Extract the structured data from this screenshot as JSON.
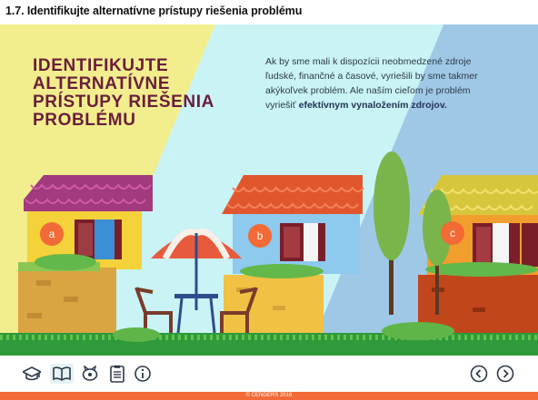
{
  "header": {
    "title": "1.7. Identifikujte alternatívne prístupy riešenia problému"
  },
  "slide": {
    "heading": "IDENTIFIKUJTE\nALTERNATÍVNE\nPRÍSTUPY RIEŠENIA\nPROBLÉMU",
    "paragraph_normal": "Ak by sme mali k dispozícii neobmedzené zdroje ľudské, finančné a časové, vyriešili by sme takmer akýkoľvek problém. Ale naším cieľom je problém vyriešiť ",
    "paragraph_bold": "efektívnym vynaložením zdrojov.",
    "options": [
      "a",
      "b",
      "c"
    ]
  },
  "toolbar": {
    "icons": [
      "graduation-cap-icon",
      "book-icon",
      "piggy-bank-icon",
      "document-icon",
      "info-icon"
    ],
    "nav": [
      "prev-arrow-icon",
      "next-arrow-icon"
    ]
  },
  "footer": {
    "copyright": "© CENGERS 2016"
  },
  "colors": {
    "heading": "#6b1d3b",
    "panel_a": "#f2ee8e",
    "panel_b": "#c9f3f5",
    "panel_c": "#9fc8e6",
    "footer": "#f26a35",
    "option_circle": "#f26a35"
  }
}
